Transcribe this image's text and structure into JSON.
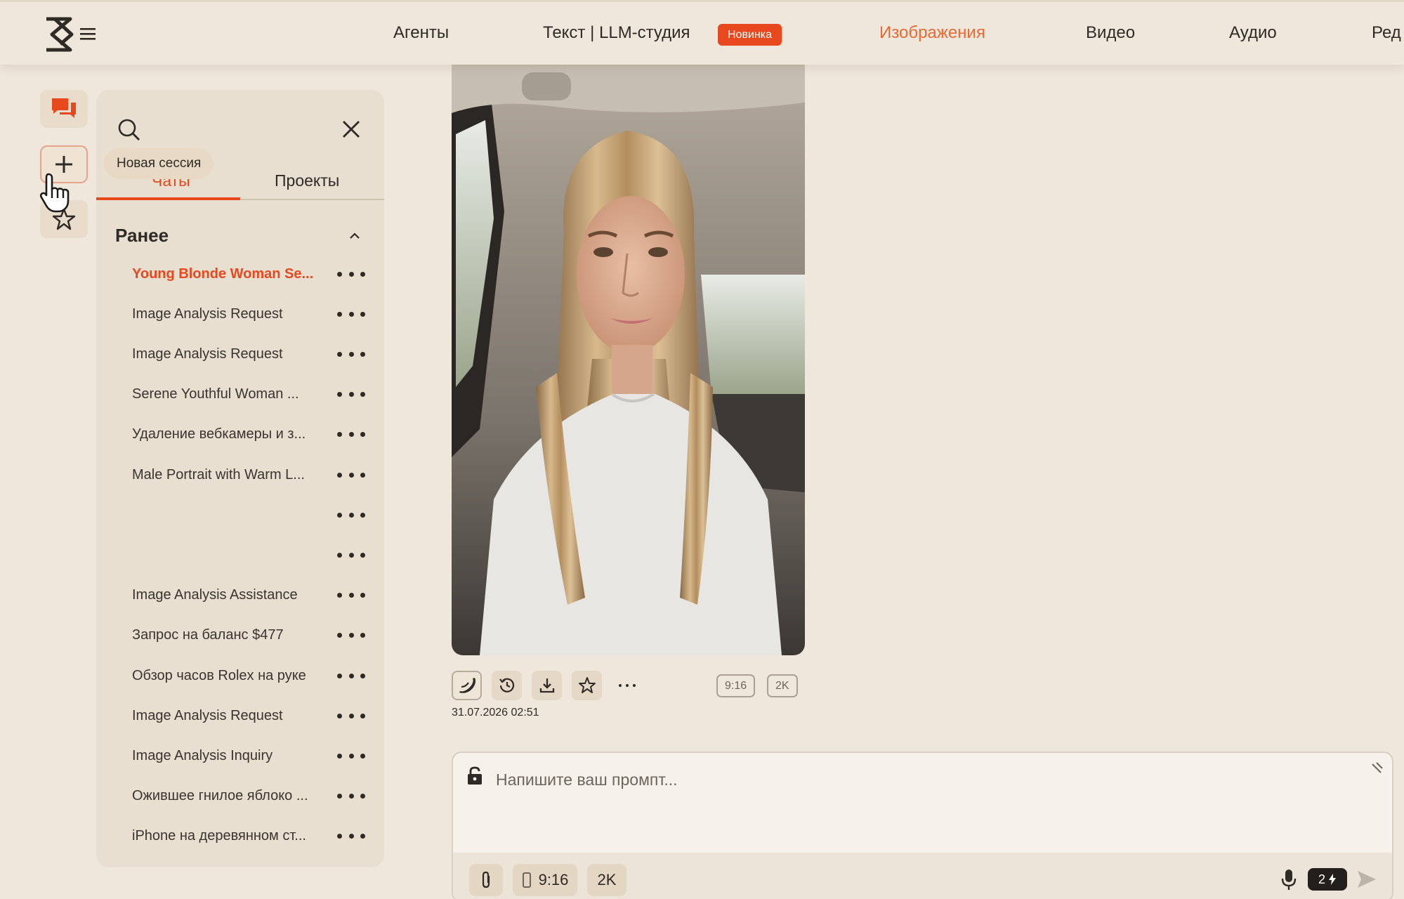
{
  "nav": {
    "items": [
      {
        "label": "Агенты"
      },
      {
        "label": "Текст | LLM-студия"
      },
      {
        "label": "Изображения"
      },
      {
        "label": "Видео"
      },
      {
        "label": "Аудио"
      },
      {
        "label": "Ред"
      }
    ],
    "badge": "Новинка",
    "active_color": "#ea6a32",
    "badge_color": "#e8481d"
  },
  "rail": {
    "icons": [
      "chat-bubbles-icon",
      "plus-icon",
      "star-icon"
    ],
    "tooltip": "Новая сессия"
  },
  "panel": {
    "tabs": [
      {
        "label": "Чаты"
      },
      {
        "label": "Проекты"
      }
    ],
    "section": "Ранее",
    "chats": [
      {
        "title": "Young Blonde Woman Se...",
        "active": true
      },
      {
        "title": "Image Analysis Request"
      },
      {
        "title": "Image Analysis Request"
      },
      {
        "title": "Serene Youthful Woman ..."
      },
      {
        "title": "Удаление вебкамеры и з..."
      },
      {
        "title": "Male Portrait with Warm L..."
      },
      {
        "title": ""
      },
      {
        "title": ""
      },
      {
        "title": "Image Analysis Assistance"
      },
      {
        "title": "Запрос на баланс $477"
      },
      {
        "title": "Обзор часов Rolex на руке"
      },
      {
        "title": "Image Analysis Request"
      },
      {
        "title": "Image Analysis Inquiry"
      },
      {
        "title": "Ожившее гнилое яблоко ..."
      },
      {
        "title": "iPhone на деревянном ст..."
      }
    ]
  },
  "result": {
    "aspect": "9:16",
    "resolution": "2K",
    "timestamp": "31.07.2026 02:51",
    "toolbar_icons": [
      "banana-icon",
      "history-icon",
      "download-icon",
      "star-icon",
      "more-icon"
    ]
  },
  "prompt": {
    "placeholder": "Напишите ваш промпт...",
    "aspect": "9:16",
    "resolution": "2K",
    "credits": "2"
  }
}
